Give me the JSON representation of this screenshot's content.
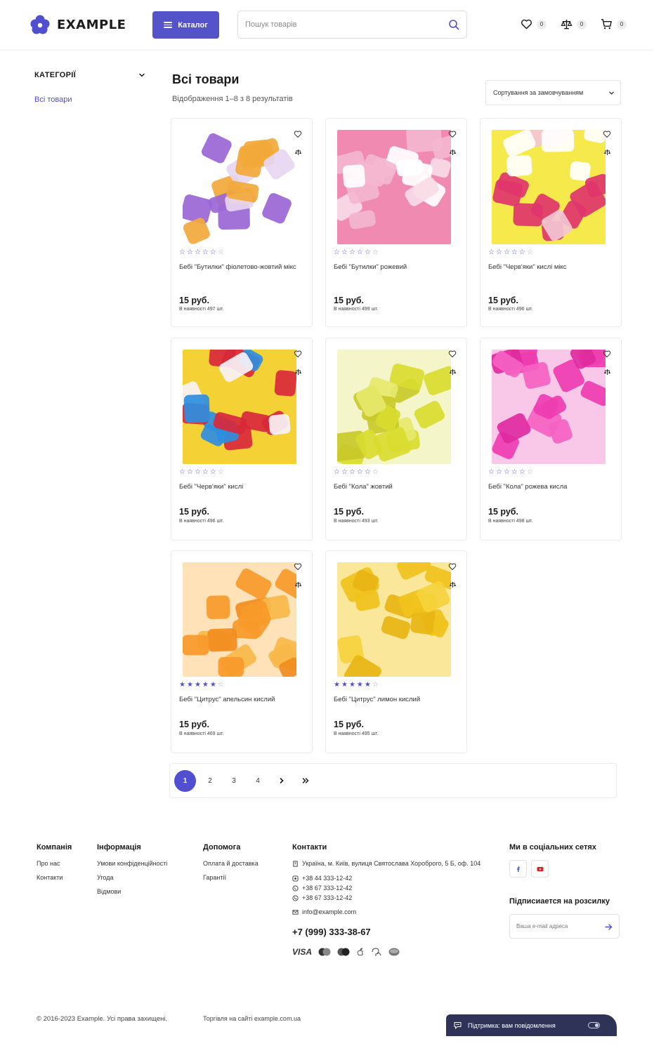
{
  "header": {
    "logo_text": "EXAMPLE",
    "catalog_label": "Каталог",
    "search_placeholder": "Пошук товарів",
    "wishlist_count": "0",
    "compare_count": "0",
    "cart_count": "0"
  },
  "sidebar": {
    "title": "КАТЕГОРІЇ",
    "items": [
      {
        "label": "Всі товари"
      }
    ]
  },
  "main": {
    "title": "Всі товари",
    "results": "Відображення 1–8 з 8 результатів",
    "sort_label": "Сортування за замовчуванням"
  },
  "products": [
    {
      "name": "Бебі \"Бутилки\" фіолетово-жовтий мікс",
      "price": "15 руб.",
      "stock": "В наявності 497 шт.",
      "rating": 0,
      "colors": [
        "#f2a93b",
        "#9b66d6",
        "#ffffff",
        "#e7d6f2"
      ]
    },
    {
      "name": "Бебі \"Бутилки\" рожевий",
      "price": "15 руб.",
      "stock": "В наявності 499 шт.",
      "rating": 0,
      "colors": [
        "#f4b6cf",
        "#ffffff",
        "#f08ab0",
        "#f8dbe6"
      ]
    },
    {
      "name": "Бебі \"Черв'яки\" кислі мікс",
      "price": "15 руб.",
      "stock": "В наявності 496 шт.",
      "rating": 0,
      "colors": [
        "#e0356b",
        "#ffffff",
        "#f6e94c",
        "#f3c6d4"
      ]
    },
    {
      "name": "Бебі \"Черв'яки\" кислі",
      "price": "15 руб.",
      "stock": "В наявності 496 шт.",
      "rating": 0,
      "colors": [
        "#d8283a",
        "#2e8ee0",
        "#f4d135",
        "#f7f2f6"
      ]
    },
    {
      "name": "Бебі \"Кола\" жовтий",
      "price": "15 руб.",
      "stock": "В наявності 493 шт.",
      "rating": 0,
      "colors": [
        "#d9dc2f",
        "#c8c92a",
        "#f4f6c9",
        "#e6e86b"
      ]
    },
    {
      "name": "Бебі \"Кола\" рожева кисла",
      "price": "15 руб.",
      "stock": "В наявності 498 шт.",
      "rating": 0,
      "colors": [
        "#ee3db1",
        "#f562c2",
        "#f9c8e8",
        "#e02aa0"
      ]
    },
    {
      "name": "Бебі \"Цитрус\" апельсин кислий",
      "price": "15 руб.",
      "stock": "В наявності 469 шт.",
      "rating": 5,
      "colors": [
        "#f79a2a",
        "#f7b84a",
        "#ffe2b8",
        "#f28c1e"
      ]
    },
    {
      "name": "Бебі \"Цитрус\" лимон кислий",
      "price": "15 руб.",
      "stock": "В наявності 495 шт.",
      "rating": 5,
      "colors": [
        "#f1c21c",
        "#e8b514",
        "#fbe79a",
        "#f6d23c"
      ]
    }
  ],
  "pagination": {
    "pages": [
      "1",
      "2",
      "3",
      "4"
    ],
    "active": "1"
  },
  "footer": {
    "company": {
      "title": "Компанія",
      "links": [
        "Про нас",
        "Контакти"
      ]
    },
    "info": {
      "title": "Інформація",
      "links": [
        "Умови конфіденційності",
        "Угода",
        "Відмови"
      ]
    },
    "help": {
      "title": "Допомога",
      "links": [
        "Оплата й доставка",
        "Гарантії"
      ]
    },
    "contacts": {
      "title": "Контакти",
      "address": "Україна, м. Київ, вулиця Святослава Хороброго, 5 Б, оф. 104",
      "phones": [
        "+38 44 333-12-42",
        "+38 67 333-12-42",
        "+38 67 333-12-42"
      ],
      "email": "info@example.com",
      "main_phone": "+7 (999) 333-38-67",
      "payment": [
        "VISA"
      ]
    },
    "social": {
      "title": "Ми в соціальних сетях"
    },
    "subscribe": {
      "title": "Підписиается на розсилку",
      "placeholder": "Ваша e-mail адреса"
    },
    "copyright": "© 2016-2023 Example. Усі права захищені.",
    "trade": "Торгівля на сайті example.com.ua"
  },
  "chat": {
    "label": "Підтримка: вам повідомлення"
  },
  "colors": {
    "accent": "#4f4fcf",
    "chat_bg": "#2f3358"
  }
}
